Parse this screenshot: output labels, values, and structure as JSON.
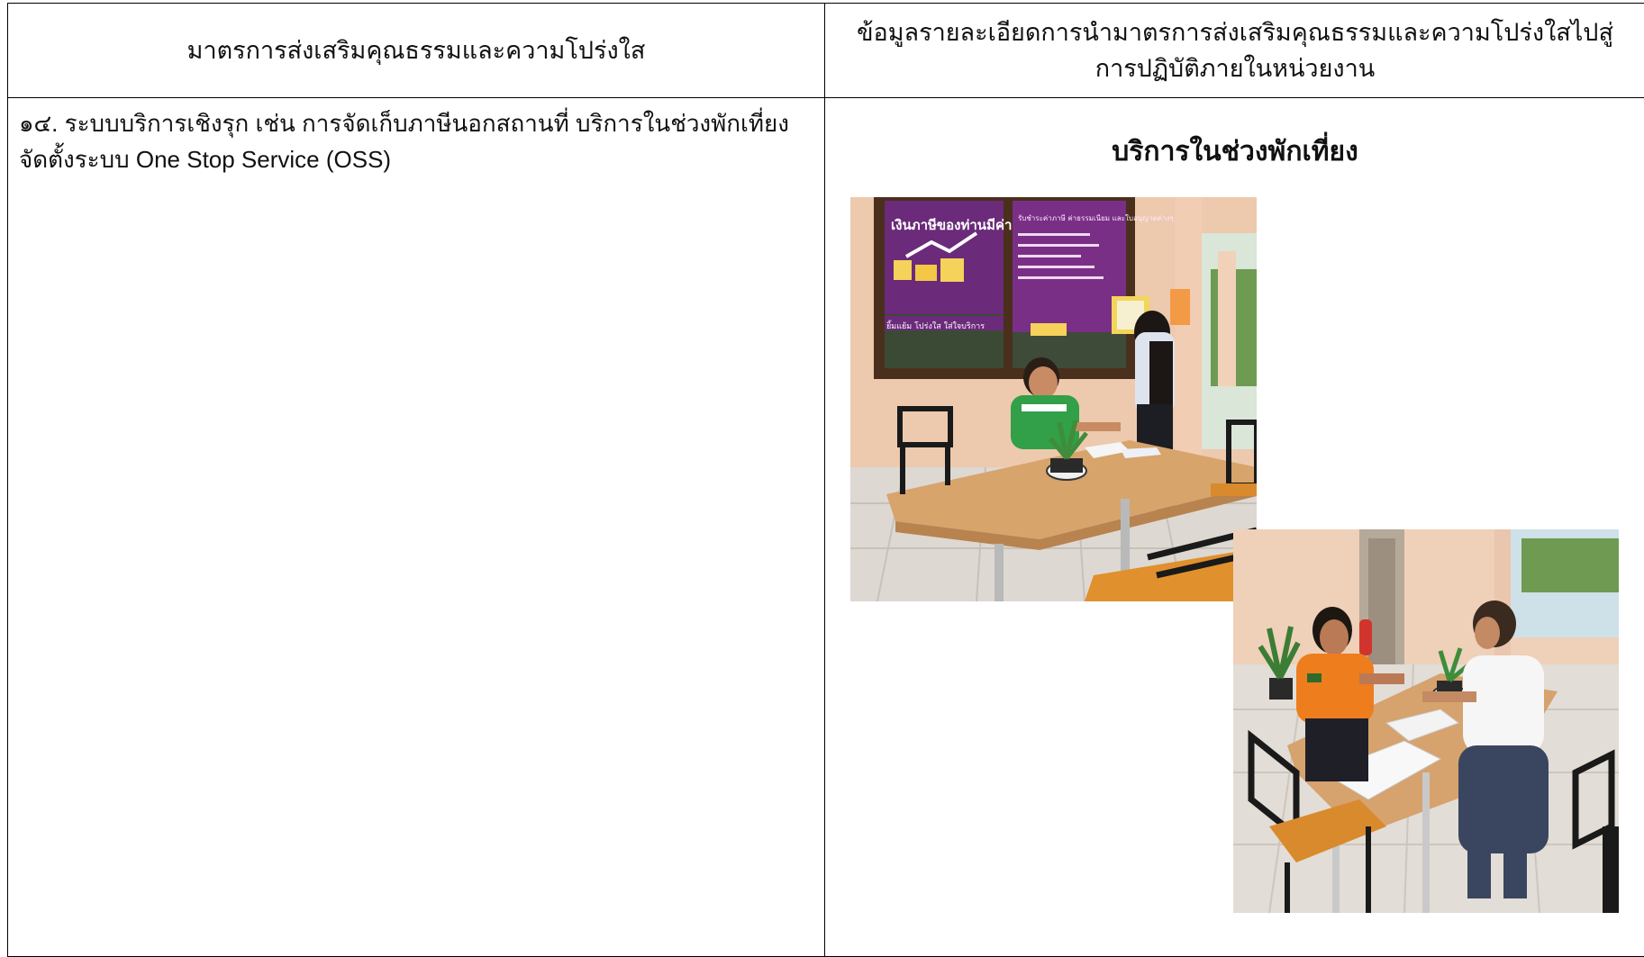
{
  "table": {
    "header_left": "มาตรการส่งเสริมคุณธรรมและความโปร่งใส",
    "header_right": "ข้อมูลรายละเอียดการนำมาตรการส่งเสริมคุณธรรมและความโปร่งใสไปสู่การปฏิบัติภายในหน่วยงาน"
  },
  "measure": {
    "line1": "๑๔. ระบบบริการเชิงรุก เช่น การจัดเก็บภาษีนอกสถานที่ บริการในช่วงพักเที่ยง",
    "line2": "จัดตั้งระบบ One Stop Service (OSS)"
  },
  "detail": {
    "title": "บริการในช่วงพักเที่ยง",
    "photo1": {
      "poster_title": "เงินภาษีของท่านมีค่า",
      "poster_side_text": "รับชำระค่าภาษี ค่าธรรมเนียม และใบอนุญาตต่างๆ",
      "poster_footer": "ยิ้มแย้ม โปร่งใส ใส่ใจบริการ"
    }
  }
}
